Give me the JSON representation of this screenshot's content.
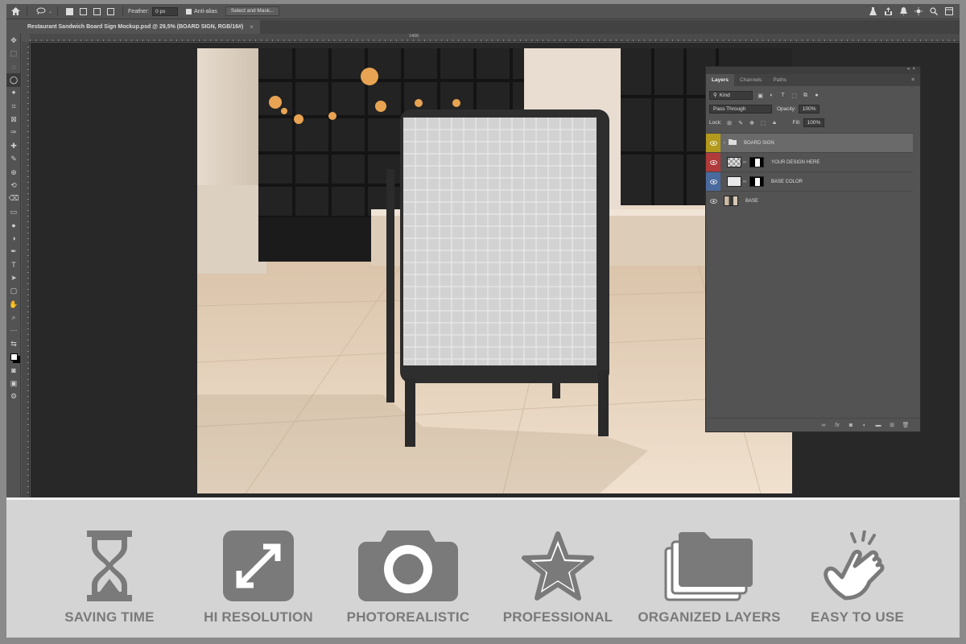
{
  "options_bar": {
    "feather_label": "Feather:",
    "feather_value": "0 px",
    "antialias_label": "Anti-alias",
    "select_mask_label": "Select and Mask..."
  },
  "document": {
    "tab_title": "Restaurant Sandwich Board Sign Mockup.psd @ 29,5% (BOARD SIGN, RGB/16#)",
    "tab_close": "×"
  },
  "ruler": {
    "labels": [
      "1400"
    ]
  },
  "layers_panel": {
    "tabs": [
      {
        "label": "Layers",
        "active": true
      },
      {
        "label": "Channels",
        "active": false
      },
      {
        "label": "Paths",
        "active": false
      }
    ],
    "filter_kind": "Kind",
    "blend_mode": "Pass Through",
    "opacity_label": "Opacity:",
    "opacity_value": "100%",
    "lock_label": "Lock:",
    "fill_label": "Fill:",
    "fill_value": "100%",
    "layers": [
      {
        "name": "BOARD SIGN",
        "type": "group",
        "eye_color": "#b49a1c"
      },
      {
        "name": "YOUR DESIGN HERE",
        "type": "smart",
        "eye_color": "#b13a3a"
      },
      {
        "name": "BASE COLOR",
        "type": "fill",
        "eye_color": "#4a6a9e"
      },
      {
        "name": "BASE",
        "type": "image",
        "eye_color": "#535353"
      }
    ]
  },
  "features": [
    {
      "label": "SAVING TIME",
      "icon": "hourglass-icon"
    },
    {
      "label": "HI RESOLUTION",
      "icon": "expand-arrows-icon"
    },
    {
      "label": "PHOTOREALISTIC",
      "icon": "camera-icon"
    },
    {
      "label": "PROFESSIONAL",
      "icon": "star-icon"
    },
    {
      "label": "ORGANIZED LAYERS",
      "icon": "stacked-folders-icon"
    },
    {
      "label": "EASY TO USE",
      "icon": "pointing-hand-icon"
    }
  ],
  "colors": {
    "ui_bg": "#535353",
    "canvas_bg": "#282828",
    "feature_gray": "#7a7a7a",
    "feature_bg": "#d4d4d4"
  }
}
